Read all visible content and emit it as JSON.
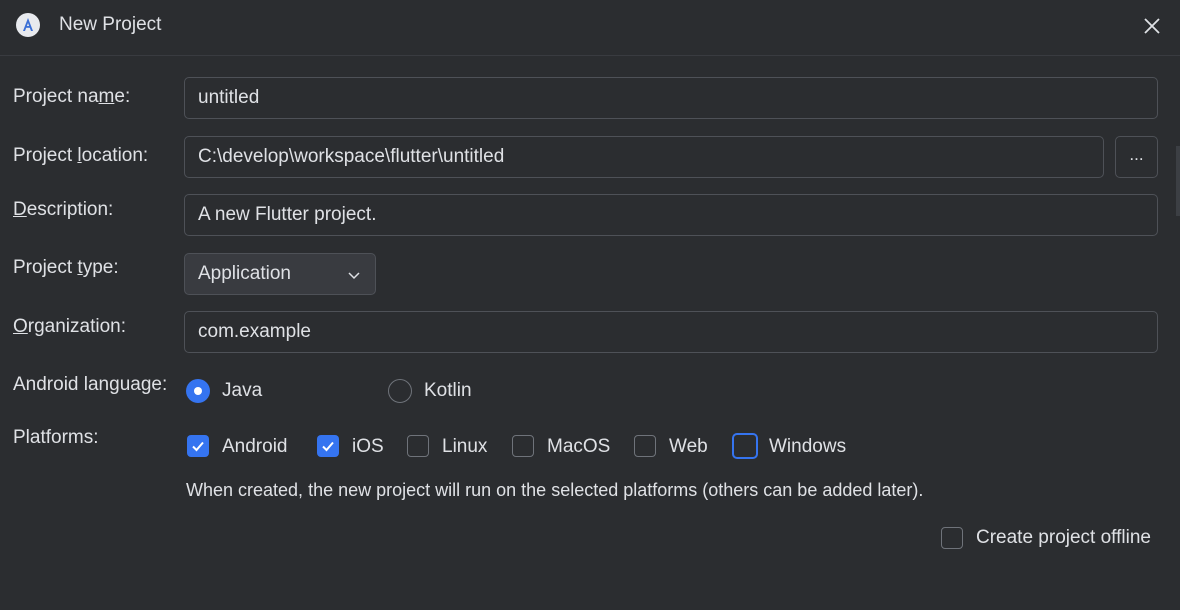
{
  "window": {
    "title": "New Project",
    "app_icon": "android-studio-icon",
    "close_icon": "close-icon"
  },
  "form": {
    "project_name": {
      "label_pre": "Project na",
      "label_mnemonic": "m",
      "label_post": "e:",
      "value": "untitled"
    },
    "project_location": {
      "label_pre": "Project ",
      "label_mnemonic": "l",
      "label_post": "ocation:",
      "value": "C:\\develop\\workspace\\flutter\\untitled",
      "browse_label": "..."
    },
    "description": {
      "label_pre": "",
      "label_mnemonic": "D",
      "label_post": "escription:",
      "value": "A new Flutter project."
    },
    "project_type": {
      "label_pre": "Project ",
      "label_mnemonic": "t",
      "label_post": "ype:",
      "selected": "Application"
    },
    "organization": {
      "label_pre": "",
      "label_mnemonic": "O",
      "label_post": "rganization:",
      "value": "com.example"
    },
    "android_language": {
      "label": "Android language:",
      "options": [
        {
          "label": "Java",
          "selected": true
        },
        {
          "label": "Kotlin",
          "selected": false
        }
      ]
    },
    "platforms": {
      "label": "Platforms:",
      "options": [
        {
          "label": "Android",
          "checked": true
        },
        {
          "label": "iOS",
          "checked": true
        },
        {
          "label": "Linux",
          "checked": false
        },
        {
          "label": "MacOS",
          "checked": false
        },
        {
          "label": "Web",
          "checked": false
        },
        {
          "label": "Windows",
          "checked": false,
          "focused": true
        }
      ],
      "hint": "When created, the new project will run on the selected platforms (others can be added later)."
    },
    "offline": {
      "label": "Create project offline",
      "checked": false
    }
  },
  "colors": {
    "background": "#2b2d30",
    "accent": "#3574f0",
    "text": "#dfe1e5",
    "border": "#4e5157"
  }
}
